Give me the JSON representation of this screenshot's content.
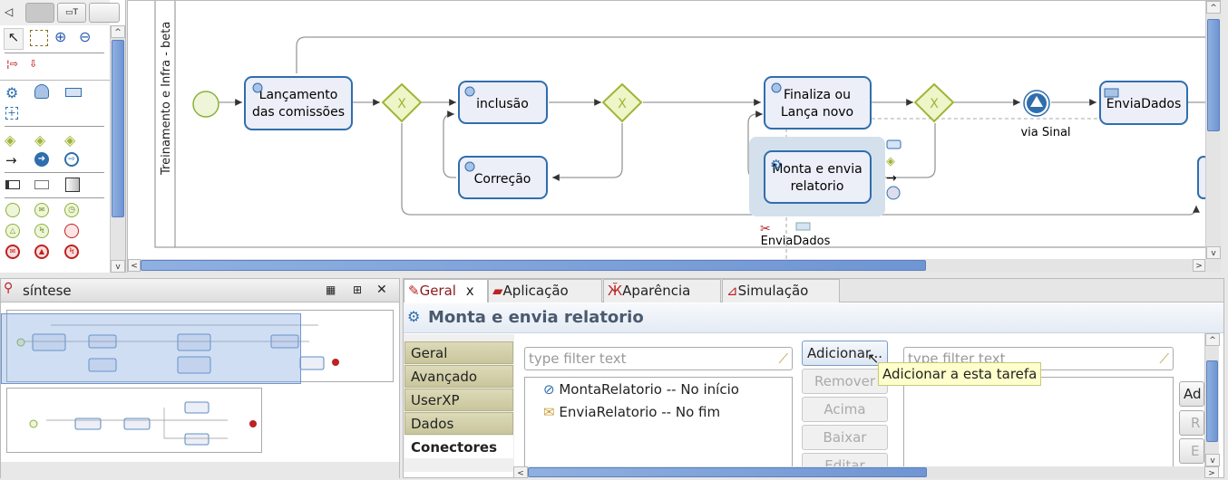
{
  "palette": {
    "tools": [
      "pointer-tool",
      "lasso-select-tool",
      "zoom-in-tool",
      "zoom-out-tool",
      "lane-tool",
      "pool-tool"
    ]
  },
  "diagram": {
    "pool_label": "Treinamento e Infra - beta",
    "tasks": {
      "lancamento": [
        "Lançamento",
        "das comissões"
      ],
      "inclusao": "inclusão",
      "correcao": "Correção",
      "finaliza": [
        "Finaliza ou",
        "Lança novo"
      ],
      "monta": [
        "Monta e envia",
        "relatorio"
      ],
      "envia_dados": "EnviaDados"
    },
    "signal_label": "via Sinal",
    "connector_label": "EnviaDados"
  },
  "overview": {
    "title": "síntese"
  },
  "properties": {
    "tabs": [
      {
        "label": "Geral",
        "close": "x"
      },
      {
        "label": "Aplicação"
      },
      {
        "label": "Aparência"
      },
      {
        "label": "Simulação"
      }
    ],
    "title": "Monta e envia relatorio",
    "side_tabs": [
      "Geral",
      "Avançado",
      "UserXP",
      "Dados",
      "Conectores"
    ],
    "filter_placeholder": "type filter text",
    "connectors": [
      {
        "name": "MontaRelatorio -- No início",
        "icon": "connector-icon"
      },
      {
        "name": "EnviaRelatorio -- No fim",
        "icon": "email-icon"
      }
    ],
    "buttons": {
      "add": "Adicionar...",
      "remove": "Remover",
      "up": "Acima",
      "down": "Baixar",
      "edit": "Editar"
    },
    "tooltip": "Adicionar a esta tarefa",
    "right_buttons": [
      "Ad",
      "R",
      "E"
    ]
  }
}
